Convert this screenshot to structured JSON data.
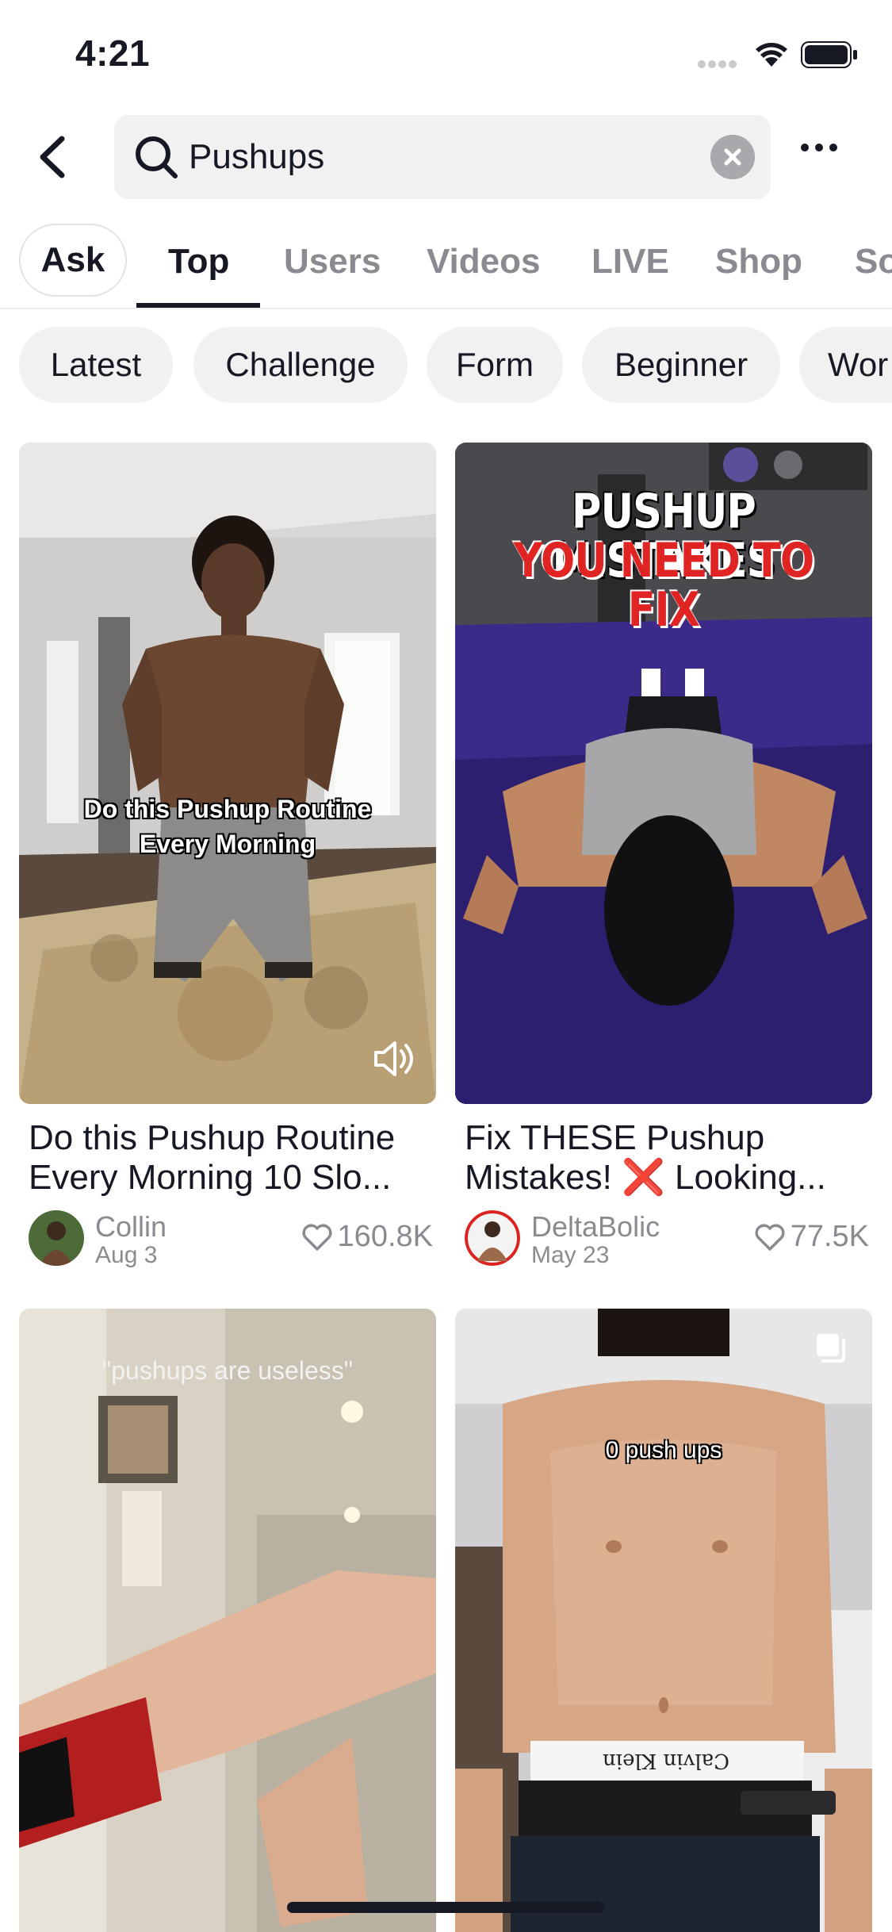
{
  "status_bar": {
    "time": "4:21"
  },
  "search": {
    "query": "Pushups"
  },
  "tabs": [
    {
      "label": "Ask"
    },
    {
      "label": "Top"
    },
    {
      "label": "Users"
    },
    {
      "label": "Videos"
    },
    {
      "label": "LIVE"
    },
    {
      "label": "Shop"
    },
    {
      "label": "So"
    }
  ],
  "active_tab": "Top",
  "chips": [
    {
      "label": "Latest"
    },
    {
      "label": "Challenge"
    },
    {
      "label": "Form"
    },
    {
      "label": "Beginner"
    },
    {
      "label": "Wor"
    }
  ],
  "videos": [
    {
      "title": "Do this Pushup Routine Every Morning 10 Slo...",
      "overlay": "Do this Pushup Routine Every Morning",
      "author": "Collin",
      "date": "Aug 3",
      "likes": "160.8K"
    },
    {
      "title": "Fix THESE Pushup Mistakes! ❌ Looking...",
      "overlay_line1": "PUSHUP MISTAKES",
      "overlay_line2": "YOU NEED TO FIX",
      "author": "DeltaBolic",
      "date": "May 23",
      "likes": "77.5K"
    },
    {
      "overlay": "\"pushups are useless\""
    },
    {
      "overlay": "0 push ups",
      "waistband": "Calvin Klein"
    }
  ],
  "colors": {
    "accent": "#161823",
    "muted": "#8a8b91",
    "chip_bg": "#f1f1f2",
    "mistake_red": "#e02424"
  }
}
